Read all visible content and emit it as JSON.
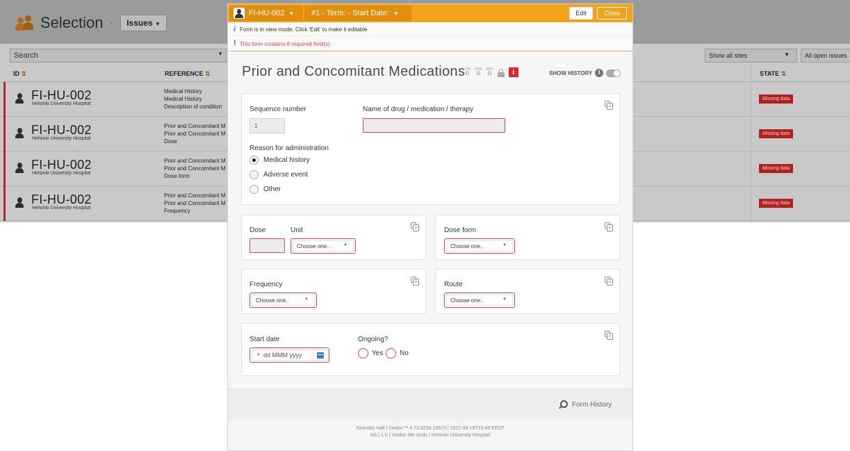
{
  "background": {
    "title": "Selection",
    "issues_button": "Issues",
    "search_placeholder": "Search",
    "sites_filter": "Show all sites",
    "issues_filter": "All open issues",
    "columns": {
      "id": "ID",
      "reference": "REFERENCE",
      "state": "STATE"
    },
    "rows": [
      {
        "id": "FI-HU-002",
        "site": "Helsinki University Hospital",
        "ref": [
          "Medical History",
          "Medical History",
          "Description of condition"
        ],
        "state": "Missing data"
      },
      {
        "id": "FI-HU-002",
        "site": "Helsinki University Hospital",
        "ref": [
          "Prior and Concomitant M",
          "Prior and Concomitant M",
          "Dose"
        ],
        "state": "Missing data"
      },
      {
        "id": "FI-HU-002",
        "site": "Helsinki University Hospital",
        "ref": [
          "Prior and Concomitant M",
          "Prior and Concomitant M",
          "Dose form"
        ],
        "state": "Missing data"
      },
      {
        "id": "FI-HU-002",
        "site": "Helsinki University Hospital",
        "ref": [
          "Prior and Concomitant M",
          "Prior and Concomitant M",
          "Frequency"
        ],
        "state": "Missing data"
      }
    ]
  },
  "modal": {
    "subject": "FI-HU-002",
    "event": "#1 - Term: - Start Date:",
    "edit_label": "Edit",
    "close_label": "Close",
    "info_text": "Form is in view mode. Click 'Edit' to make it editable",
    "required_text": "This form contains 8 required field(s)",
    "form_title": "Prior and Concomitant Medications",
    "signatures": [
      "DM",
      "CRA",
      "SDV"
    ],
    "show_history_label": "SHOW HISTORY",
    "history_count": "1",
    "sections": {
      "main": {
        "sequence_label": "Sequence number",
        "sequence_value": "1",
        "drug_label": "Name of drug / medication / therapy",
        "reason_label": "Reason for administration",
        "reason_options": [
          "Medical history",
          "Adverse event",
          "Other"
        ],
        "reason_selected": "Medical history"
      },
      "dose": {
        "dose_label": "Dose",
        "unit_label": "Unit",
        "unit_placeholder": "Choose one.."
      },
      "dose_form": {
        "label": "Dose form",
        "placeholder": "Choose one.."
      },
      "frequency": {
        "label": "Frequency",
        "placeholder": "Choose one.."
      },
      "route": {
        "label": "Route",
        "placeholder": "Choose one.."
      },
      "dates": {
        "start_label": "Start date",
        "start_placeholder": "dd MMM yyyy",
        "ongoing_label": "Ongoing?",
        "yes": "Yes",
        "no": "No"
      }
    },
    "form_history_label": "Form History",
    "footer_line1": "Nicholas Hall | Viedoc™ 4.72.8258.15573 | 2022-08-16T15:49 EEST",
    "footer_line2": "NA | 1.0 | Viedoc Me study | Helsinki University Hospital"
  },
  "colors": {
    "accent": "#f3a21c",
    "error": "#e24545",
    "state_badge": "#b21f1f"
  }
}
